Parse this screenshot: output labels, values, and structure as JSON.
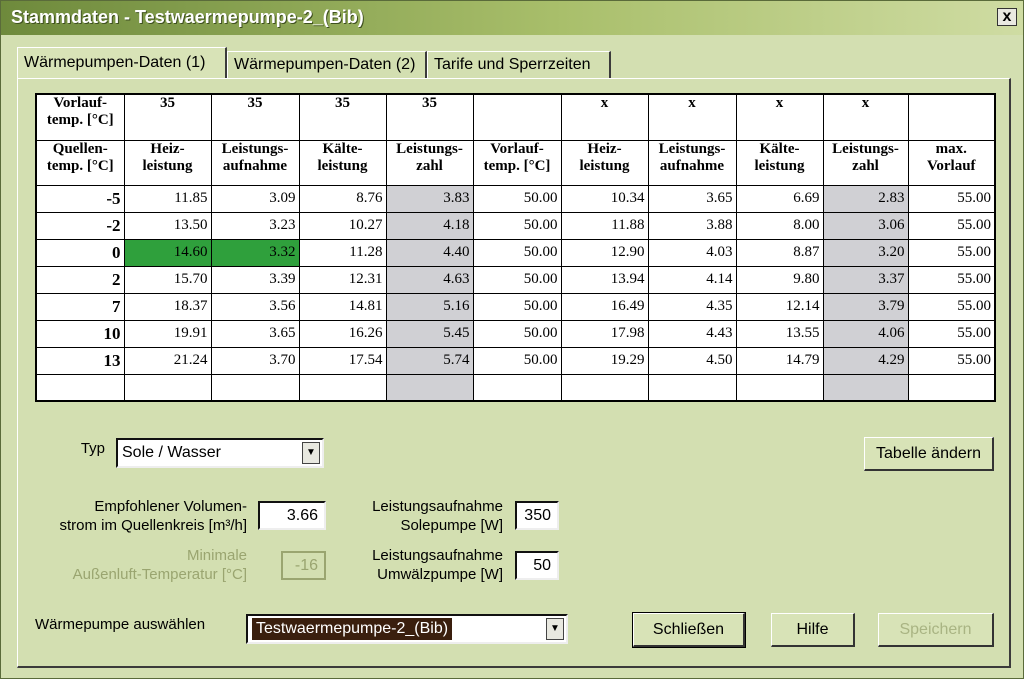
{
  "window": {
    "title": "Stammdaten - Testwaermepumpe-2_(Bib)",
    "close_label": "x"
  },
  "tabs": [
    {
      "label": "Wärmepumpen-Daten (1)"
    },
    {
      "label": "Wärmepumpen-Daten (2)"
    },
    {
      "label": "Tarife und Sperrzeiten"
    }
  ],
  "table": {
    "row1": [
      "Vorlauf- temp. [°C]",
      "35",
      "35",
      "35",
      "35",
      "",
      "x",
      "x",
      "x",
      "x",
      ""
    ],
    "row2": [
      "Quellen- temp. [°C]",
      "Heiz- leistung",
      "Leistungs- aufnahme",
      "Kälte- leistung",
      "Leistungs- zahl",
      "Vorlauf- temp. [°C]",
      "Heiz- leistung",
      "Leistungs- aufnahme",
      "Kälte- leistung",
      "Leistungs- zahl",
      "max. Vorlauf"
    ],
    "rows": [
      [
        "-5",
        "11.85",
        "3.09",
        "8.76",
        "3.83",
        "50.00",
        "10.34",
        "3.65",
        "6.69",
        "2.83",
        "55.00"
      ],
      [
        "-2",
        "13.50",
        "3.23",
        "10.27",
        "4.18",
        "50.00",
        "11.88",
        "3.88",
        "8.00",
        "3.06",
        "55.00"
      ],
      [
        "0",
        "14.60",
        "3.32",
        "11.28",
        "4.40",
        "50.00",
        "12.90",
        "4.03",
        "8.87",
        "3.20",
        "55.00"
      ],
      [
        "2",
        "15.70",
        "3.39",
        "12.31",
        "4.63",
        "50.00",
        "13.94",
        "4.14",
        "9.80",
        "3.37",
        "55.00"
      ],
      [
        "7",
        "18.37",
        "3.56",
        "14.81",
        "5.16",
        "50.00",
        "16.49",
        "4.35",
        "12.14",
        "3.79",
        "55.00"
      ],
      [
        "10",
        "19.91",
        "3.65",
        "16.26",
        "5.45",
        "50.00",
        "17.98",
        "4.43",
        "13.55",
        "4.06",
        "55.00"
      ],
      [
        "13",
        "21.24",
        "3.70",
        "17.54",
        "5.74",
        "50.00",
        "19.29",
        "4.50",
        "14.79",
        "4.29",
        "55.00"
      ],
      [
        "",
        "",
        "",
        "",
        "",
        "",
        "",
        "",
        "",
        "",
        ""
      ]
    ]
  },
  "form": {
    "typ_label": "Typ",
    "typ_value": "Sole / Wasser",
    "volumen_label_1": "Empfohlener Volumen-",
    "volumen_label_2": "strom im Quellenkreis [m³/h]",
    "volumen_value": "3.66",
    "min_label_1": "Minimale",
    "min_label_2": "Außenluft-Temperatur [°C]",
    "min_value": "-16",
    "sole_label_1": "Leistungsaufnahme",
    "sole_label_2": "Solepumpe [W]",
    "sole_value": "350",
    "umwaelz_label_1": "Leistungsaufnahme",
    "umwaelz_label_2": "Umwälzpumpe [W]",
    "umwaelz_value": "50",
    "wp_label": "Wärmepumpe auswählen",
    "wp_value": "Testwaermepumpe-2_(Bib)"
  },
  "buttons": {
    "tabelle": "Tabelle ändern",
    "schliessen": "Schließen",
    "hilfe": "Hilfe",
    "speichern": "Speichern"
  },
  "colors": {
    "highlight_green": "#2fa03c",
    "cop_gray": "#d0d0d4",
    "window_bg": "#d3dfb1"
  }
}
